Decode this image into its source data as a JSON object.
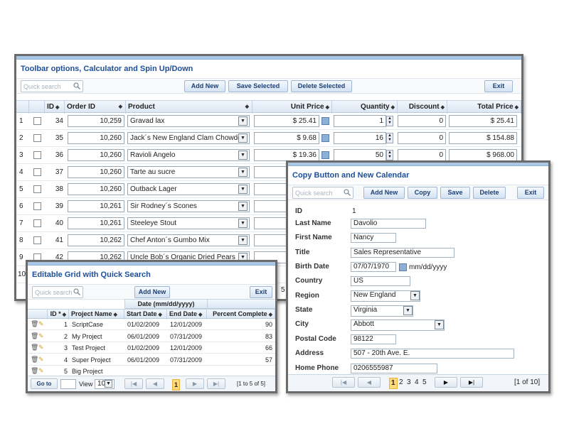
{
  "panel1": {
    "title": "Toolbar options, Calculator and Spin Up/Down",
    "search_placeholder": "Quick search",
    "buttons": {
      "add_new": "Add New",
      "save_selected": "Save Selected",
      "delete_selected": "Delete Selected",
      "exit": "Exit"
    },
    "headers": {
      "id": "ID",
      "order_id": "Order ID",
      "product": "Product",
      "unit_price": "Unit Price",
      "quantity": "Quantity",
      "discount": "Discount",
      "total_price": "Total Price"
    },
    "rows": [
      {
        "n": "1",
        "id": "34",
        "order_id": "10,259",
        "product": "Gravad lax",
        "unit_price": "$ 25.41",
        "quantity": "1",
        "discount": "0",
        "total": "$ 25.41"
      },
      {
        "n": "2",
        "id": "35",
        "order_id": "10,260",
        "product": "Jack´s New England Clam Chowder",
        "unit_price": "$ 9.68",
        "quantity": "16",
        "discount": "0",
        "total": "$ 154.88"
      },
      {
        "n": "3",
        "id": "36",
        "order_id": "10,260",
        "product": "Ravioli Angelo",
        "unit_price": "$ 19.36",
        "quantity": "50",
        "discount": "0",
        "total": "$ 968.00"
      },
      {
        "n": "4",
        "id": "37",
        "order_id": "10,260",
        "product": "Tarte au sucre",
        "unit_price": "",
        "quantity": "",
        "discount": "",
        "total": ""
      },
      {
        "n": "5",
        "id": "38",
        "order_id": "10,260",
        "product": "Outback Lager",
        "unit_price": "",
        "quantity": "",
        "discount": "",
        "total": ""
      },
      {
        "n": "6",
        "id": "39",
        "order_id": "10,261",
        "product": "Sir Rodney´s Scones",
        "unit_price": "",
        "quantity": "",
        "discount": "",
        "total": ""
      },
      {
        "n": "7",
        "id": "40",
        "order_id": "10,261",
        "product": "Steeleye Stout",
        "unit_price": "",
        "quantity": "",
        "discount": "",
        "total": ""
      },
      {
        "n": "8",
        "id": "41",
        "order_id": "10,262",
        "product": "Chef Anton´s Gumbo Mix",
        "unit_price": "",
        "quantity": "",
        "discount": "",
        "total": ""
      },
      {
        "n": "9",
        "id": "42",
        "order_id": "10,262",
        "product": "Uncle Bob´s Organic Dried Pears",
        "unit_price": "",
        "quantity": "",
        "discount": "",
        "total": ""
      }
    ],
    "partial_row_number": "10",
    "partial_page_digit": "5"
  },
  "panel2": {
    "title": "Copy Button and New Calendar",
    "search_placeholder": "Quick search",
    "buttons": {
      "add_new": "Add New",
      "copy": "Copy",
      "save": "Save",
      "delete": "Delete",
      "exit": "Exit"
    },
    "fields": {
      "id_label": "ID",
      "id_value": "1",
      "last_name_label": "Last Name",
      "last_name": "Davolio",
      "first_name_label": "First Name",
      "first_name": "Nancy",
      "title_label": "Title",
      "title_value": "Sales Representative",
      "birth_date_label": "Birth Date",
      "birth_date": "07/07/1970",
      "birth_date_format": "mm/dd/yyyy",
      "country_label": "Country",
      "country": "US",
      "region_label": "Region",
      "region": "New England",
      "state_label": "State",
      "state": "Virginia",
      "city_label": "City",
      "city": "Abbott",
      "postal_code_label": "Postal Code",
      "postal_code": "98122",
      "address_label": "Address",
      "address": "507 - 20th Ave. E.",
      "home_phone_label": "Home Phone",
      "home_phone": "0206555987"
    },
    "pager": {
      "pages": [
        "1",
        "2",
        "3",
        "4",
        "5"
      ],
      "current": "1",
      "info": "[1 of 10]"
    }
  },
  "panel3": {
    "title": "Editable Grid with Quick Search",
    "search_placeholder": "Quick search",
    "buttons": {
      "add_new": "Add New",
      "exit": "Exit"
    },
    "group_header": "Date (mm/dd/yyyy)",
    "headers": {
      "id": "ID *",
      "project_name": "Project Name",
      "start_date": "Start Date",
      "end_date": "End Date",
      "percent": "Percent Complete"
    },
    "rows": [
      {
        "id": "1",
        "name": "ScriptCase",
        "start": "01/02/2009",
        "end": "12/01/2009",
        "pct": "90"
      },
      {
        "id": "2",
        "name": "My Project",
        "start": "06/01/2009",
        "end": "07/31/2009",
        "pct": "83"
      },
      {
        "id": "3",
        "name": "Test Project",
        "start": "01/02/2009",
        "end": "12/01/2009",
        "pct": "66"
      },
      {
        "id": "4",
        "name": "Super Project",
        "start": "06/01/2009",
        "end": "07/31/2009",
        "pct": "57"
      },
      {
        "id": "5",
        "name": "Big Project",
        "start": "",
        "end": "",
        "pct": ""
      }
    ],
    "pager": {
      "goto": "Go to",
      "view_label": "View",
      "view_value": "10",
      "current": "1",
      "info": "[1 to 5 of 5]"
    }
  }
}
